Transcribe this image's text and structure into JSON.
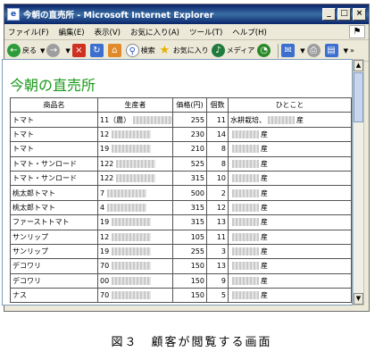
{
  "window": {
    "title": "今朝の直売所 - Microsoft Internet Explorer",
    "buttons": {
      "minimize": "_",
      "maximize": "□",
      "close": "×"
    }
  },
  "menubar": {
    "items": [
      "ファイル(F)",
      "編集(E)",
      "表示(V)",
      "お気に入り(A)",
      "ツール(T)",
      "ヘルプ(H)"
    ]
  },
  "toolbar": {
    "back_label": "戻る",
    "search_label": "検索",
    "favorites_label": "お気に入り",
    "media_label": "メディア",
    "more": "»"
  },
  "page": {
    "heading": "今朝の直売所",
    "columns": [
      "商品名",
      "生産者",
      "価格(円)",
      "個数",
      "ひとこと"
    ],
    "rows": [
      {
        "product": "トマト",
        "producer": "11（農）",
        "price": "255",
        "count": "11",
        "comment_text": "水耕栽培、",
        "comment_suffix": "産"
      },
      {
        "product": "トマト",
        "producer": "12",
        "price": "230",
        "count": "14",
        "comment_text": "",
        "comment_suffix": "産"
      },
      {
        "product": "トマト",
        "producer": "19",
        "price": "210",
        "count": "8",
        "comment_text": "",
        "comment_suffix": "産"
      },
      {
        "product": "トマト・サンロード",
        "producer": "122",
        "price": "525",
        "count": "8",
        "comment_text": "",
        "comment_suffix": "産"
      },
      {
        "product": "トマト・サンロード",
        "producer": "122",
        "price": "315",
        "count": "10",
        "comment_text": "",
        "comment_suffix": "産"
      },
      {
        "product": "桃太郎トマト",
        "producer": "7",
        "price": "500",
        "count": "2",
        "comment_text": "",
        "comment_suffix": "産"
      },
      {
        "product": "桃太郎トマト",
        "producer": "4",
        "price": "315",
        "count": "12",
        "comment_text": "",
        "comment_suffix": "産"
      },
      {
        "product": "ファーストトマト",
        "producer": "19",
        "price": "315",
        "count": "13",
        "comment_text": "",
        "comment_suffix": "産"
      },
      {
        "product": "サンリップ",
        "producer": "12",
        "price": "105",
        "count": "11",
        "comment_text": "",
        "comment_suffix": "産"
      },
      {
        "product": "サンリップ",
        "producer": "19",
        "price": "255",
        "count": "3",
        "comment_text": "",
        "comment_suffix": "産"
      },
      {
        "product": "デコワリ",
        "producer": "70",
        "price": "150",
        "count": "13",
        "comment_text": "",
        "comment_suffix": "産"
      },
      {
        "product": "デコワリ",
        "producer": "00",
        "price": "150",
        "count": "9",
        "comment_text": "",
        "comment_suffix": "産"
      },
      {
        "product": "ナス",
        "producer": "70",
        "price": "150",
        "count": "5",
        "comment_text": "",
        "comment_suffix": "産"
      }
    ]
  },
  "caption": "図３　顧客が閲覧する画面"
}
